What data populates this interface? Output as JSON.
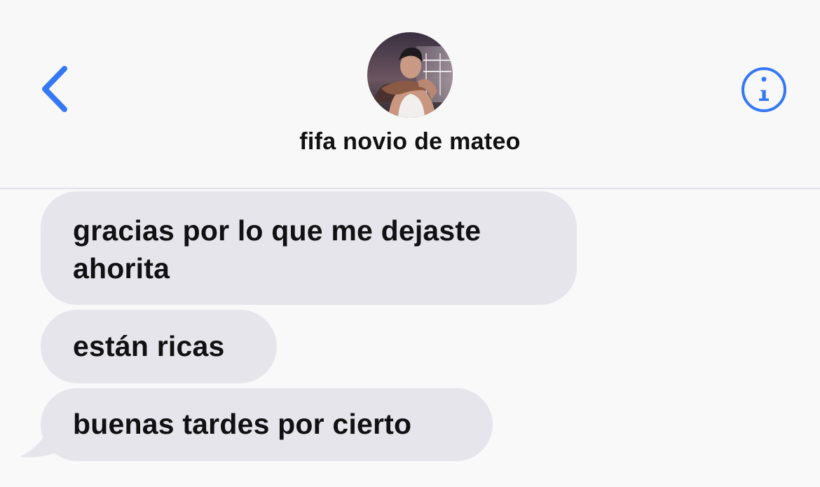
{
  "header": {
    "contact_name": "fifa novio de mateo",
    "back_icon": "chevron-left-icon",
    "info_icon": "info-circle-icon",
    "accent_color": "#3478f6"
  },
  "messages": [
    {
      "direction": "incoming",
      "text_line1": "gracias por lo que me dejaste",
      "text_line2": "ahorita"
    },
    {
      "direction": "incoming",
      "text": "están ricas"
    },
    {
      "direction": "incoming",
      "text": "buenas tardes por cierto"
    }
  ],
  "colors": {
    "background": "#f9f9fa",
    "incoming_bubble": "#e6e5eb",
    "divider": "#e3e2e8",
    "text": "#111111"
  }
}
